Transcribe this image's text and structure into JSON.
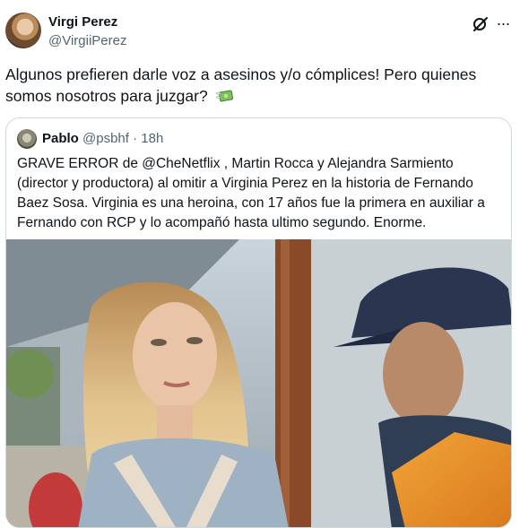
{
  "author": {
    "display_name": "Virgi Perez",
    "handle": "@VirgiiPerez"
  },
  "tweet": {
    "text": "Algunos prefieren darle voz a asesinos y/o cómplices! Pero quienes somos nosotros para juzgar?",
    "emoji": "money-with-wings"
  },
  "icons": {
    "grok": "grok-icon",
    "more": "more-options-icon"
  },
  "quoted_tweet": {
    "display_name": "Pablo",
    "handle": "@psbhf",
    "separator": "·",
    "time": "18h",
    "text": "GRAVE ERROR de @CheNetflix , Martin Rocca y Alejandra Sarmiento (director y productora) al omitir a Virginia Perez en la historia de Fernando Baez Sosa. Virginia es una heroina, con 17 años fue la primera en auxiliar a Fernando con RCP y lo acompañó hasta ultimo segundo. Enorme."
  },
  "colors": {
    "text_primary": "#0f1419",
    "text_secondary": "#536471",
    "border": "#cfd9de"
  }
}
